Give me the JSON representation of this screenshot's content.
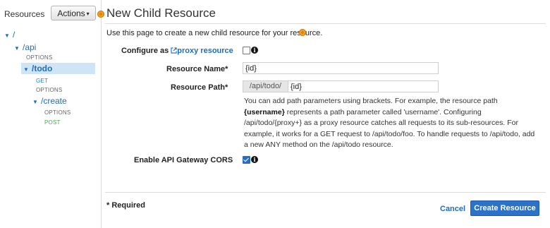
{
  "sidebar": {
    "title": "Resources",
    "actions_label": "Actions",
    "tree": {
      "root": "/",
      "api": "/api",
      "api_options": "OPTIONS",
      "todo": "/todo",
      "todo_get": "GET",
      "todo_options": "OPTIONS",
      "create": "/create",
      "create_options": "OPTIONS",
      "create_post": "POST"
    }
  },
  "main": {
    "title": "New Child Resource",
    "intro": "Use this page to create a new child resource for your resource.",
    "configure_proxy": {
      "label_prefix": "Configure as",
      "link": "proxy resource",
      "checked": false
    },
    "resource_name": {
      "label": "Resource Name*",
      "value": "{id}"
    },
    "resource_path": {
      "label": "Resource Path*",
      "prefix": "/api/todo/",
      "value": "{id}"
    },
    "help": {
      "p1": "You can add path parameters using brackets. For example, the resource path ",
      "p1_bold": "{username}",
      "p2": " represents a path parameter called 'username'. Configuring /api/todo/{proxy+} as a proxy resource catches all requests to its sub-resources. For example, it works for a GET request to /api/todo/foo. To handle requests to /api/todo, add a new ANY method on the /api/todo resource."
    },
    "cors": {
      "label": "Enable API Gateway CORS",
      "checked": true
    },
    "required_note": "* Required",
    "cancel_label": "Cancel",
    "create_label": "Create Resource"
  },
  "icons": {
    "info": "info-icon",
    "external_link": "external-link-icon",
    "highlight_marker": "orange-dot-marker"
  },
  "colors": {
    "link": "#1f6eb5",
    "primary_button": "#2b72c8",
    "selected_row": "#cfe4f7",
    "post_method": "#47a84b",
    "marker": "#f7a21b"
  }
}
